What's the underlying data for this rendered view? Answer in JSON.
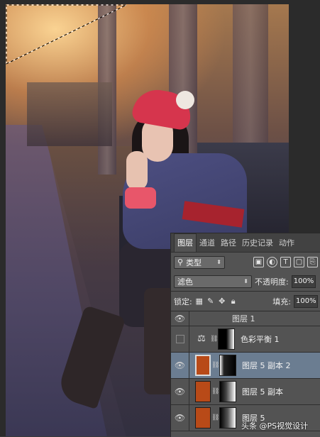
{
  "panel": {
    "tabs": [
      "图层",
      "通道",
      "路径",
      "历史记录",
      "动作"
    ],
    "active_tab": "图层",
    "filter_label": "类型",
    "blend_mode": "滤色",
    "opacity_label": "不透明度:",
    "opacity_value": "100%",
    "lock_label": "锁定:",
    "fill_label": "填充:",
    "fill_value": "100%"
  },
  "layers": [
    {
      "name": "图层 1",
      "visible": true,
      "partial": true
    },
    {
      "name": "色彩平衡 1",
      "visible": false,
      "type": "adjustment"
    },
    {
      "name": "图层 5 副本 2",
      "visible": true,
      "selected": true,
      "thumb_color": "#b84a18"
    },
    {
      "name": "图层 5 副本",
      "visible": true,
      "thumb_color": "#b84a18"
    },
    {
      "name": "图层 5",
      "visible": true,
      "thumb_color": "#b84a18"
    }
  ],
  "watermark": "头条 @PS视觉设计",
  "colors": {
    "panel_bg": "#535353",
    "tab_bar": "#424242",
    "selected_layer": "#6b7d91",
    "layer_thumb": "#b84a18"
  }
}
